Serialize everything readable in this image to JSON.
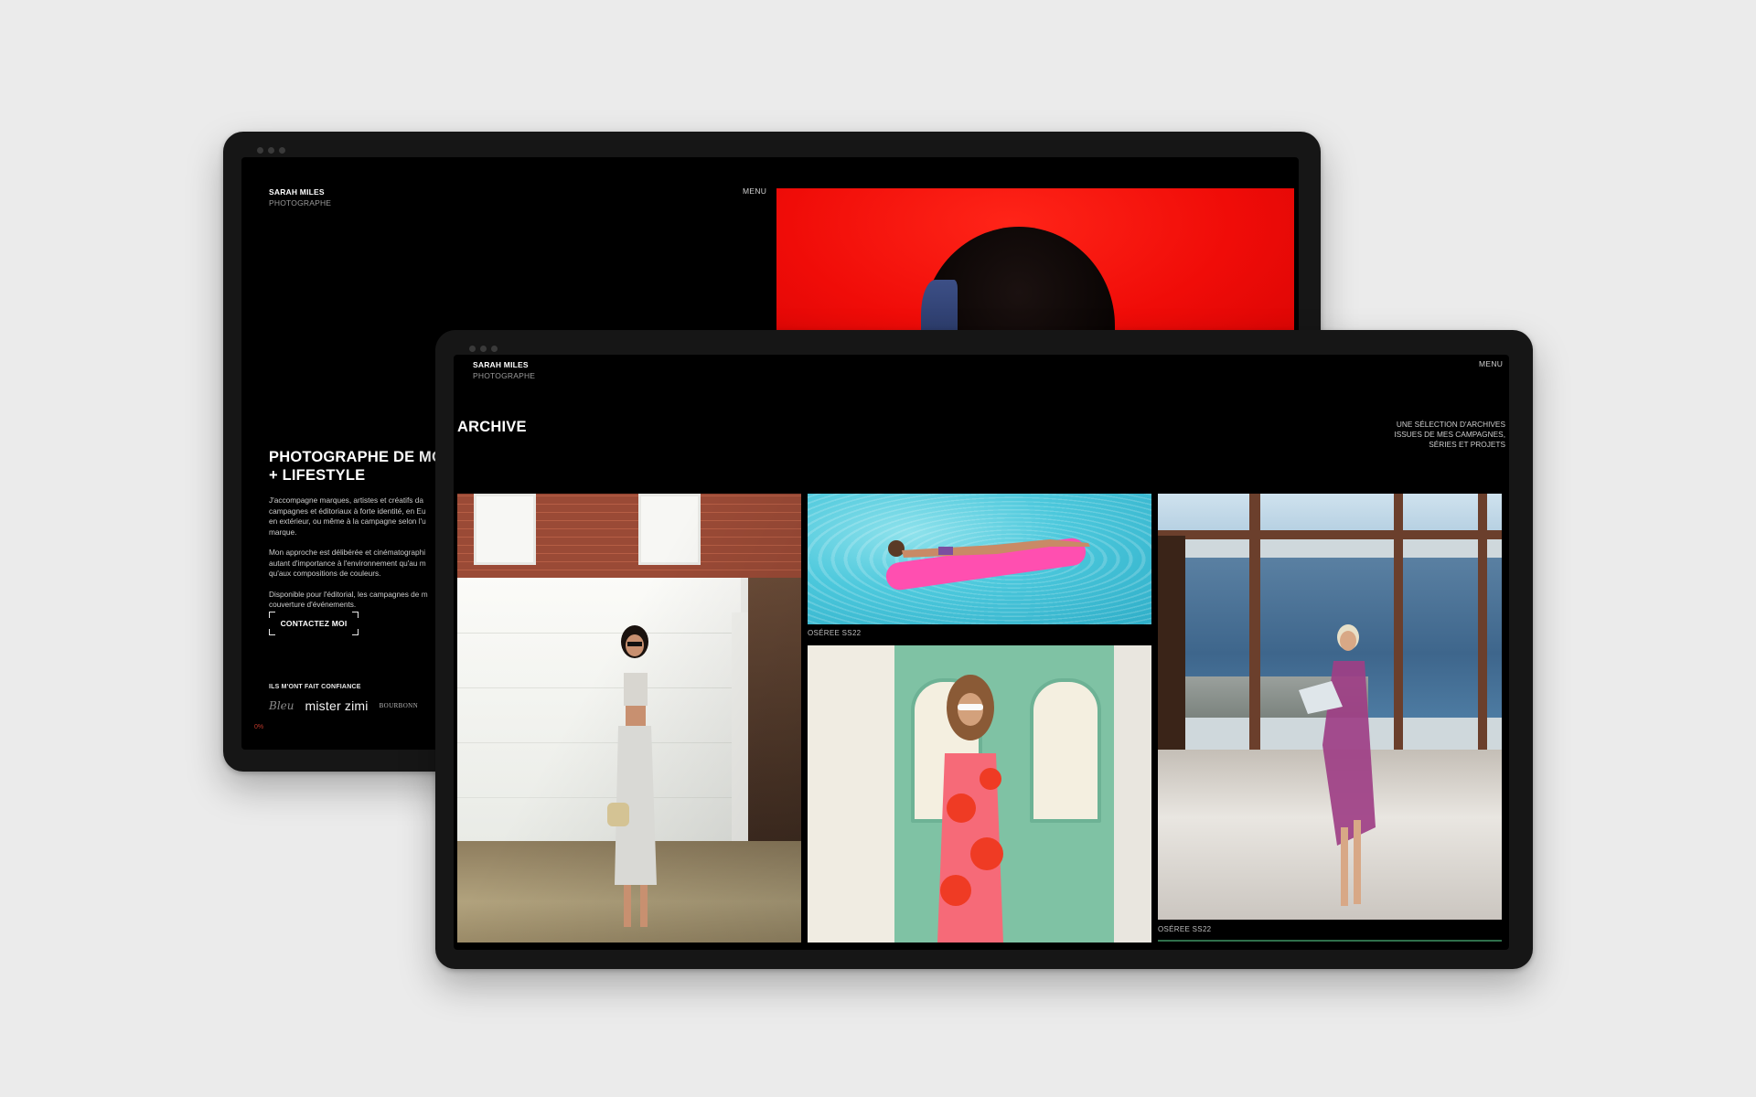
{
  "back": {
    "brand_name": "SARAH MILES",
    "brand_sub": "PHOTOGRAPHE",
    "menu": "MENU",
    "hero_title_line1": "PHOTOGRAPHE DE MO",
    "hero_title_line2": "+ LIFESTYLE",
    "paragraphs": [
      [
        "J'accompagne marques, artistes et créatifs da",
        "campagnes et éditoriaux à forte identité, en Eu",
        "en extérieur, ou même à la campagne selon l'u",
        "marque."
      ],
      [
        "Mon approche est délibérée et cinématographi",
        "autant d'importance à l'environnement qu'au m",
        "qu'aux compositions de couleurs."
      ],
      [
        "Disponible pour l'éditorial, les campagnes de m",
        "couverture d'événements."
      ]
    ],
    "cta": "CONTACTEZ MOI",
    "trust_label": "ILS M'ONT FAIT CONFIANCE",
    "logos": [
      "Bleu",
      "mister zimi",
      "BOURBONN"
    ],
    "progress": "0%"
  },
  "front": {
    "brand_name": "SARAH MILES",
    "brand_sub": "PHOTOGRAPHE",
    "menu": "MENU",
    "title": "ARCHIVE",
    "description": [
      "UNE SÉLECTION D'ARCHIVES",
      "ISSUES DE MES CAMPAGNES,",
      "SÉRIES ET PROJETS"
    ],
    "captions": {
      "pool": "OSÉREE SS22",
      "seaside": "OSÉREE SS22"
    }
  },
  "colors": {
    "page_bg": "#ebebeb",
    "device": "#161616",
    "screen": "#000000",
    "hero_red": "#f00c08",
    "accent_red": "#c0392b"
  }
}
